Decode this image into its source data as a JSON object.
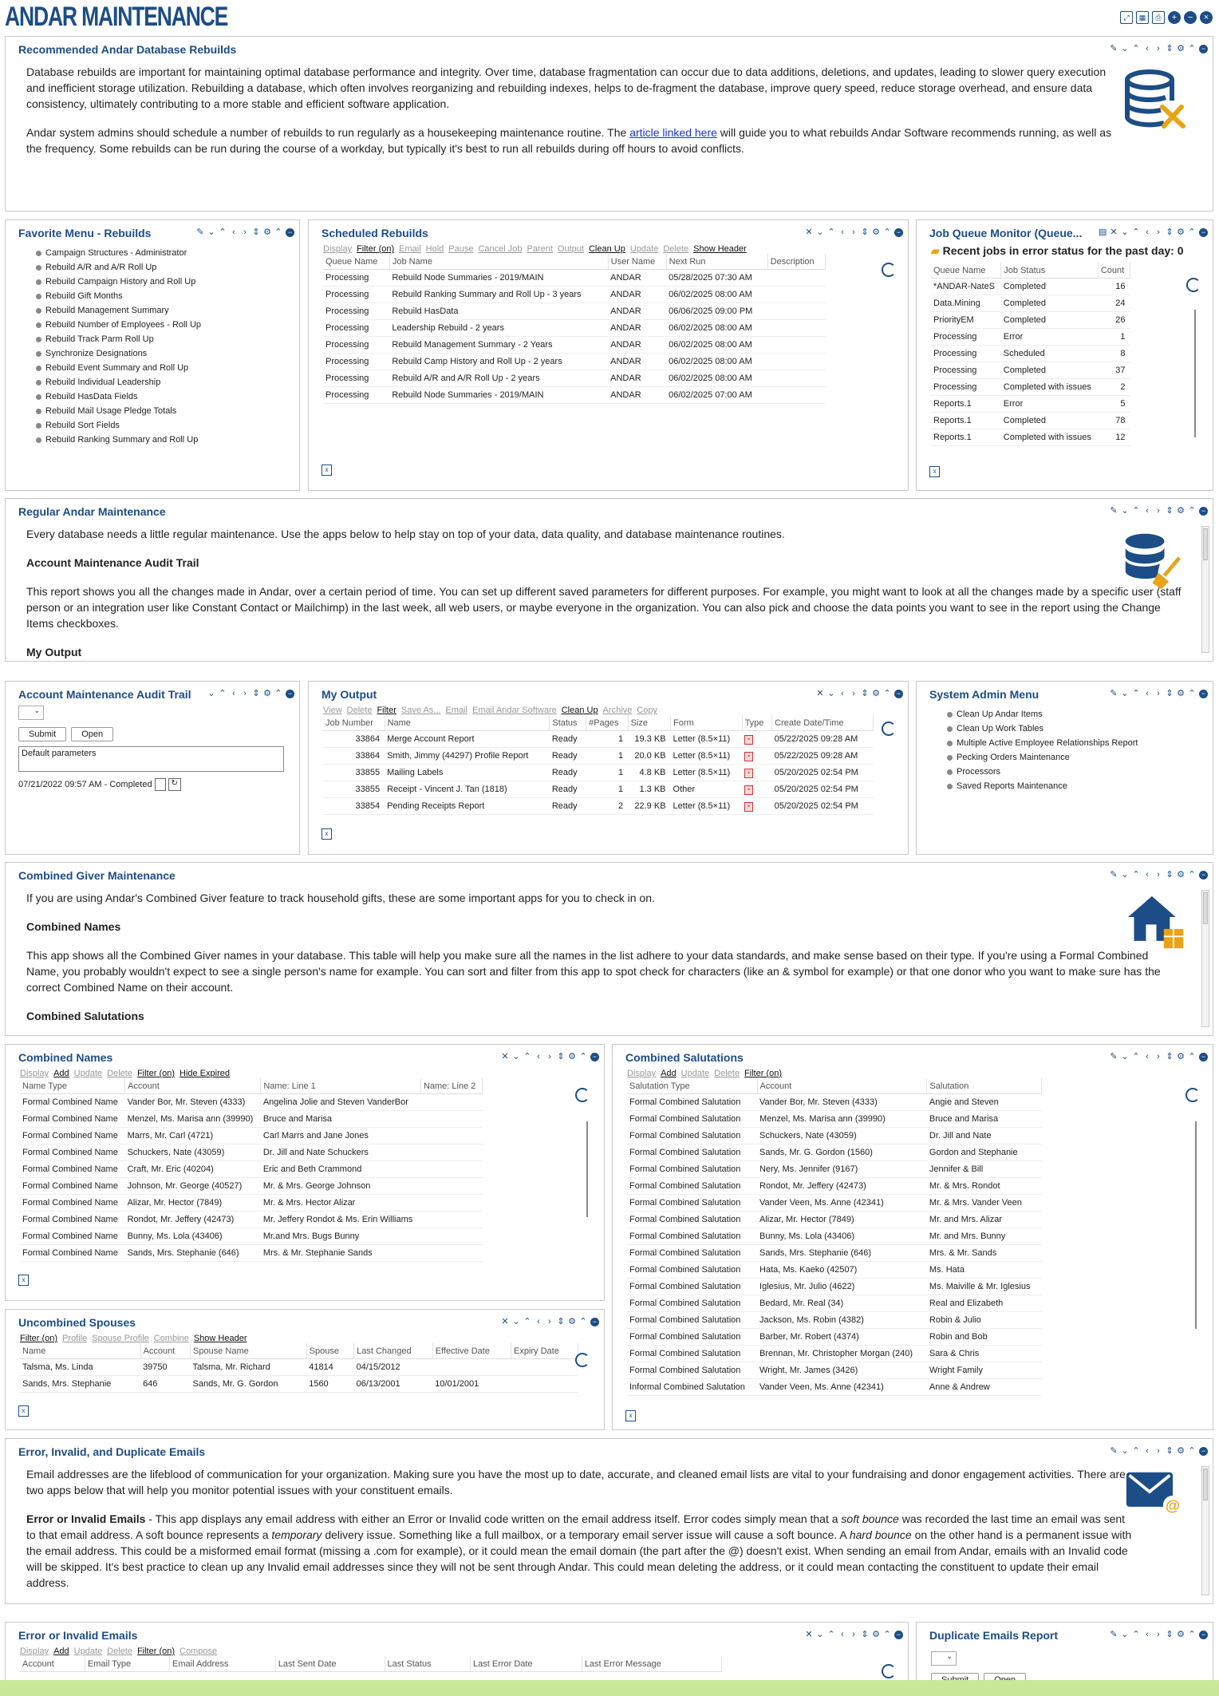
{
  "app_title": "ANDAR MAINTENANCE",
  "top_icons": [
    "expand-icon",
    "grid-icon",
    "print-icon",
    "add-icon",
    "minus-icon",
    "close-icon"
  ],
  "rebuilds_info": {
    "title": "Recommended Andar Database Rebuilds",
    "p1": "Database rebuilds are important for maintaining optimal database performance and integrity. Over time, database fragmentation can occur due to data additions, deletions, and updates, leading to slower query execution and inefficient storage utilization. Rebuilding a database, which often involves reorganizing and rebuilding indexes, helps to de-fragment the database, improve query speed, reduce storage overhead, and ensure data consistency, ultimately contributing to a more stable and efficient software application.",
    "p2a": "Andar system admins should schedule a number of rebuilds to run regularly as a housekeeping maintenance routine. The ",
    "p2link": "article linked here",
    "p2b": " will guide you to what rebuilds Andar Software recommends running, as well as the frequency. Some rebuilds can be run during the course of a workday, but typically it's best to run all rebuilds during off hours to avoid conflicts."
  },
  "favorite_menu": {
    "title": "Favorite Menu - Rebuilds",
    "items": [
      "Campaign Structures - Administrator",
      "Rebuild A/R and A/R Roll Up",
      "Rebuild Campaign History and Roll Up",
      "Rebuild Gift Months",
      "Rebuild Management Summary",
      "Rebuild Number of Employees - Roll Up",
      "Rebuild Track Parm Roll Up",
      "Synchronize Designations",
      "Rebuild Event Summary and Roll Up",
      "Rebuild Individual Leadership",
      "Rebuild HasData Fields",
      "Rebuild Mail Usage Pledge Totals",
      "Rebuild Sort Fields",
      "Rebuild Ranking Summary and Roll Up"
    ]
  },
  "scheduled": {
    "title": "Scheduled Rebuilds",
    "toolbar": [
      "Display",
      "Filter (on)",
      "Email",
      "Hold",
      "Pause",
      "Cancel Job",
      "Parent",
      "Output",
      "Clean Up",
      "Update",
      "Delete",
      "Show Header"
    ],
    "columns": [
      "Queue Name",
      "Job Name",
      "User Name",
      "Next Run",
      "Description"
    ],
    "rows": [
      [
        "Processing",
        "Rebuild Node Summaries - 2019/MAIN",
        "ANDAR",
        "05/28/2025 07:30 AM"
      ],
      [
        "Processing",
        "Rebuild Ranking Summary and Roll Up - 3 years",
        "ANDAR",
        "06/02/2025 08:00 AM"
      ],
      [
        "Processing",
        "Rebuild HasData",
        "ANDAR",
        "06/06/2025 09:00 PM"
      ],
      [
        "Processing",
        "Leadership Rebuild - 2 years",
        "ANDAR",
        "06/02/2025 08:00 AM"
      ],
      [
        "Processing",
        "Rebuild Management Summary - 2 Years",
        "ANDAR",
        "06/02/2025 08:00 AM"
      ],
      [
        "Processing",
        "Rebuild Camp History and Roll Up - 2 years",
        "ANDAR",
        "06/02/2025 08:00 AM"
      ],
      [
        "Processing",
        "Rebuild A/R and A/R Roll Up - 2 years",
        "ANDAR",
        "06/02/2025 08:00 AM"
      ],
      [
        "Processing",
        "Rebuild Node Summaries - 2019/MAIN",
        "ANDAR",
        "06/02/2025 07:00 AM"
      ]
    ]
  },
  "jobqueue": {
    "title": "Job Queue Monitor (Queue...",
    "heading": "Recent jobs in error status for the past day: 0",
    "columns": [
      "Queue Name",
      "Job Status",
      "Count"
    ],
    "rows": [
      [
        "*ANDAR-NateS",
        "Completed",
        "16"
      ],
      [
        "Data.Mining",
        "Completed",
        "24"
      ],
      [
        "PriorityEM",
        "Completed",
        "26"
      ],
      [
        "Processing",
        "Error",
        "1"
      ],
      [
        "Processing",
        "Scheduled",
        "8"
      ],
      [
        "Processing",
        "Completed",
        "37"
      ],
      [
        "Processing",
        "Completed with issues",
        "2"
      ],
      [
        "Reports.1",
        "Error",
        "5"
      ],
      [
        "Reports.1",
        "Completed",
        "78"
      ],
      [
        "Reports.1",
        "Completed with issues",
        "12"
      ]
    ]
  },
  "regular": {
    "title": "Regular Andar Maintenance",
    "p1": "Every database needs a little regular maintenance. Use the apps below to help stay on top of your data, data quality, and database maintenance routines.",
    "h1": "Account Maintenance Audit Trail",
    "p2": "This report shows you all the changes made in Andar, over a certain period of time. You can set up different saved parameters for different purposes. For example, you might want to look at all the changes made by a specific user (staff person or an integration user like Constant Contact or Mailchimp) in the last week, all web users, or maybe everyone in the organization. You can also pick and choose the data points you want to see in the report using the Change Items checkboxes.",
    "h2": "My Output"
  },
  "audit": {
    "title": "Account Maintenance Audit Trail",
    "submit": "Submit",
    "open": "Open",
    "params": "Default parameters",
    "status": "07/21/2022 09:57 AM - Completed"
  },
  "myoutput": {
    "title": "My Output",
    "toolbar": [
      "View",
      "Delete",
      "Filter",
      "Save As...",
      "Email",
      "Email Andar Software",
      "Clean Up",
      "Archive",
      "Copy"
    ],
    "columns": [
      "Job Number",
      "Name",
      "Status",
      "#Pages",
      "Size",
      "Form",
      "Type",
      "Create Date/Time"
    ],
    "rows": [
      [
        "33864",
        "Merge Account Report",
        "Ready",
        "1",
        "19.3 KB",
        "Letter (8.5×11)",
        "05/22/2025 09:28 AM"
      ],
      [
        "33864",
        "Smith, Jimmy  (44297) Profile Report",
        "Ready",
        "1",
        "20.0 KB",
        "Letter (8.5×11)",
        "05/22/2025 09:28 AM"
      ],
      [
        "33855",
        "Mailing Labels",
        "Ready",
        "1",
        "4.8 KB",
        "Letter (8.5×11)",
        "05/20/2025 02:54 PM"
      ],
      [
        "33855",
        "Receipt - Vincent J. Tan (1818)",
        "Ready",
        "1",
        "1.3 KB",
        "Other",
        "05/20/2025 02:54 PM"
      ],
      [
        "33854",
        "Pending Receipts Report",
        "Ready",
        "2",
        "22.9 KB",
        "Letter (8.5×11)",
        "05/20/2025 02:54 PM"
      ]
    ]
  },
  "sysadmin": {
    "title": "System Admin Menu",
    "items": [
      "Clean Up Andar Items",
      "Clean Up Work Tables",
      "Multiple Active Employee Relationships Report",
      "Pecking Orders Maintenance",
      "Processors",
      "Saved Reports Maintenance"
    ]
  },
  "combined": {
    "title": "Combined Giver Maintenance",
    "p1": "If you are using Andar's Combined Giver feature to track household gifts, these are some important apps for you to check in on.",
    "h1": "Combined Names",
    "p2": "This app shows all the Combined Giver names in your database. This table will help you make sure all the names in the list adhere to your data standards, and make sense based on their type. If you're using a Formal Combined Name, you probably wouldn't expect to see a single person's name for example. You can sort and filter from this app to spot check for characters (like an & symbol for example) or that one donor who you want to make sure has the correct Combined Name on their account.",
    "h2": "Combined Salutations"
  },
  "cnames": {
    "title": "Combined Names",
    "toolbar": [
      "Display",
      "Add",
      "Update",
      "Delete",
      "Filter (on)",
      "Hide Expired"
    ],
    "columns": [
      "Name Type",
      "Account",
      "Name: Line 1",
      "Name: Line 2"
    ],
    "rows": [
      [
        "Formal Combined Name",
        "Vander Bor, Mr. Steven  (4333)",
        "Angelina Jolie and Steven VanderBor"
      ],
      [
        "Formal Combined Name",
        "Menzel, Ms. Marisa ann (39990)",
        "Bruce and Marisa"
      ],
      [
        "Formal Combined Name",
        "Marrs, Mr. Carl  (4721)",
        "Carl Marrs  and Jane Jones"
      ],
      [
        "Formal Combined Name",
        "Schuckers, Nate  (43059)",
        "Dr. Jill and Nate Schuckers"
      ],
      [
        "Formal Combined Name",
        "Craft, Mr. Eric  (40204)",
        "Eric and Beth Crammond"
      ],
      [
        "Formal Combined Name",
        "Johnson, Mr. George  (40527)",
        "Mr. & Mrs. George Johnson"
      ],
      [
        "Formal Combined Name",
        "Alizar, Mr. Hector  (7849)",
        "Mr. & Mrs. Hector Alizar"
      ],
      [
        "Formal Combined Name",
        "Rondot, Mr. Jeffery  (42473)",
        "Mr. Jeffery Rondot & Ms. Erin Williams"
      ],
      [
        "Formal Combined Name",
        "Bunny, Ms. Lola  (43406)",
        "Mr.and Mrs. Bugs Bunny"
      ],
      [
        "Formal Combined Name",
        "Sands, Mrs. Stephanie  (646)",
        "Mrs. & Mr. Stephanie Sands"
      ]
    ]
  },
  "csal": {
    "title": "Combined Salutations",
    "toolbar": [
      "Display",
      "Add",
      "Update",
      "Delete",
      "Filter (on)"
    ],
    "columns": [
      "Salutation Type",
      "Account",
      "Salutation"
    ],
    "rows": [
      [
        "Formal Combined Salutation",
        "Vander Bor, Mr. Steven  (4333)",
        "Angie and Steven"
      ],
      [
        "Formal Combined Salutation",
        "Menzel, Ms. Marisa ann (39990)",
        "Bruce and Marisa"
      ],
      [
        "Formal Combined Salutation",
        "Schuckers, Nate  (43059)",
        "Dr. Jill and Nate"
      ],
      [
        "Formal Combined Salutation",
        "Sands, Mr. G. Gordon  (1560)",
        "Gordon and Stephanie"
      ],
      [
        "Formal Combined Salutation",
        "Nery, Ms. Jennifer  (9167)",
        "Jennifer & Bill"
      ],
      [
        "Formal Combined Salutation",
        "Rondot, Mr. Jeffery  (42473)",
        "Mr. & Mrs. Rondot"
      ],
      [
        "Formal Combined Salutation",
        "Vander Veen, Ms. Anne  (42341)",
        "Mr. & Mrs. Vander Veen"
      ],
      [
        "Formal Combined Salutation",
        "Alizar, Mr. Hector  (7849)",
        "Mr. and Mrs. Alizar"
      ],
      [
        "Formal Combined Salutation",
        "Bunny, Ms. Lola  (43406)",
        "Mr. and Mrs. Bunny"
      ],
      [
        "Formal Combined Salutation",
        "Sands, Mrs. Stephanie  (646)",
        "Mrs. & Mr. Sands"
      ],
      [
        "Formal Combined Salutation",
        "Hata, Ms. Kaeko  (42507)",
        "Ms.  Hata"
      ],
      [
        "Formal Combined Salutation",
        "Iglesius, Mr. Julio  (4622)",
        "Ms. Maiville & Mr. Iglesius"
      ],
      [
        "Formal Combined Salutation",
        "Bedard, Mr. Real  (34)",
        "Real and Elizabeth"
      ],
      [
        "Formal Combined Salutation",
        "Jackson, Ms. Robin  (4382)",
        "Robin & Julio"
      ],
      [
        "Formal Combined Salutation",
        "Barber, Mr. Robert  (4374)",
        "Robin and Bob"
      ],
      [
        "Formal Combined Salutation",
        "Brennan, Mr. Christopher Morgan  (240)",
        "Sara & Chris"
      ],
      [
        "Formal Combined Salutation",
        "Wright, Mr. James  (3426)",
        "Wright Family"
      ],
      [
        "Informal Combined Salutation",
        "Vander Veen, Ms. Anne  (42341)",
        "Anne & Andrew"
      ]
    ]
  },
  "uncombined": {
    "title": "Uncombined Spouses",
    "toolbar": [
      "Filter (on)",
      "Profile",
      "Spouse Profile",
      "Combine",
      "Show Header"
    ],
    "columns": [
      "Name",
      "Account",
      "Spouse Name",
      "Spouse",
      "Last Changed",
      "Effective Date",
      "Expiry Date"
    ],
    "rows": [
      [
        "Talsma, Ms. Linda",
        "39750",
        "Talsma, Mr. Richard",
        "41814",
        "04/15/2012",
        "",
        ""
      ],
      [
        "Sands, Mrs. Stephanie",
        "646",
        "Sands, Mr. G. Gordon",
        "1560",
        "06/13/2001",
        "10/01/2001",
        ""
      ]
    ]
  },
  "emails": {
    "title": "Error, Invalid, and Duplicate Emails",
    "p1": "Email addresses are the lifeblood of communication for your organization. Making sure you have the most up to date, accurate, and cleaned email lists are vital to your fundraising and donor engagement activities. There are two apps below that will help you monitor potential issues with your constituent emails.",
    "b1": "Error or Invalid Emails",
    "t1": " - This app displays any email address with either an Error or Invalid code written on the email address itself. Error codes simply mean that a ",
    "i1": "soft bounce",
    "t2": " was recorded the last time an email was sent to that email address. A soft bounce represents a ",
    "i2": "temporary",
    "t3": " delivery issue. Something like a full mailbox, or a temporary email server issue will cause a soft bounce. A ",
    "i3": "hard bounce",
    "t4": " on the other hand is a permanent issue with the email address. This could be a misformed email format (missing a .com for example), or it could mean the email domain (the part after the @) doesn't exist. When sending an email from Andar, emails with an Invalid code will be skipped. It's best practice to clean up any Invalid email addresses since they will not be sent through Andar. This could mean deleting the address, or it could mean contacting the constituent to update their email address."
  },
  "errinv": {
    "title": "Error or Invalid Emails",
    "toolbar": [
      "Display",
      "Add",
      "Update",
      "Delete",
      "Filter (on)",
      "Compose"
    ],
    "columns": [
      "Account",
      "Email Type",
      "Email Address",
      "Last Sent Date",
      "Last Status",
      "Last Error Date",
      "Last Error Message"
    ]
  },
  "dup": {
    "title": "Duplicate Emails Report",
    "submit": "Submit",
    "open": "Open"
  }
}
